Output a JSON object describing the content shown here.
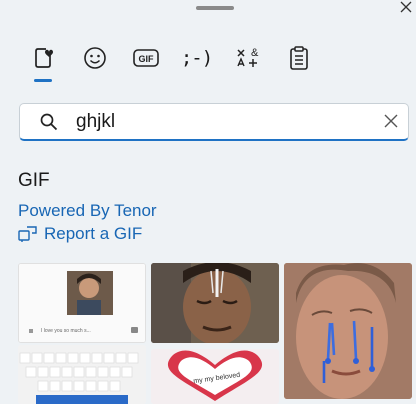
{
  "search": {
    "value": "ghjkl"
  },
  "tabs": [
    {
      "name": "Favorites",
      "icon": "heart-sticker-icon",
      "active": true
    },
    {
      "name": "Emoji",
      "icon": "smiley-icon"
    },
    {
      "name": "GIF",
      "icon": "gif-icon",
      "label": "GIF"
    },
    {
      "name": "Kaomoji",
      "icon": "kaomoji-icon",
      "label": ";-)"
    },
    {
      "name": "Symbols",
      "icon": "symbols-icon"
    },
    {
      "name": "Clipboard",
      "icon": "clipboard-icon"
    }
  ],
  "section": {
    "title": "GIF",
    "powered_by": "Powered By Tenor",
    "report": "Report a GIF"
  },
  "gifs": [
    {
      "caption": "I love you so much s..."
    },
    {
      "caption": ""
    },
    {
      "caption": ""
    },
    {
      "caption": ""
    },
    {
      "caption": "my my beloved"
    }
  ],
  "colors": {
    "accent": "#1f72c4",
    "link": "#1866b4",
    "background": "#eef2f5"
  }
}
